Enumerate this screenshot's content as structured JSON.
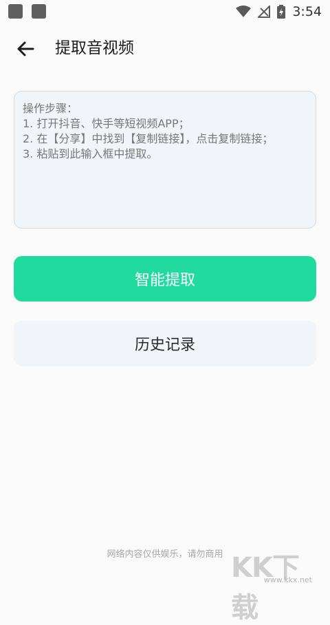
{
  "status_bar": {
    "time": "3:54",
    "icons": [
      "notification-square-icon",
      "notification-square-icon",
      "wifi-icon",
      "no-signal-icon",
      "battery-charging-icon"
    ]
  },
  "header": {
    "back_icon": "arrow-left-icon",
    "title": "提取音视频"
  },
  "link_input": {
    "value": "",
    "placeholder": "操作步骤：\n1. 打开抖音、快手等短视频APP；\n2. 在【分享】中找到【复制链接】，点击复制链接；\n3. 粘贴到此输入框中提取。"
  },
  "buttons": {
    "extract_label": "智能提取",
    "history_label": "历史记录"
  },
  "footer": {
    "disclaimer": "网络内容仅供娱乐，请勿商用"
  },
  "watermark": {
    "text": "KK下载",
    "url": "www.kkx.net"
  },
  "colors": {
    "accent": "#20da9e",
    "secondary_button": "#f1f4f8",
    "background": "#fafafa"
  }
}
